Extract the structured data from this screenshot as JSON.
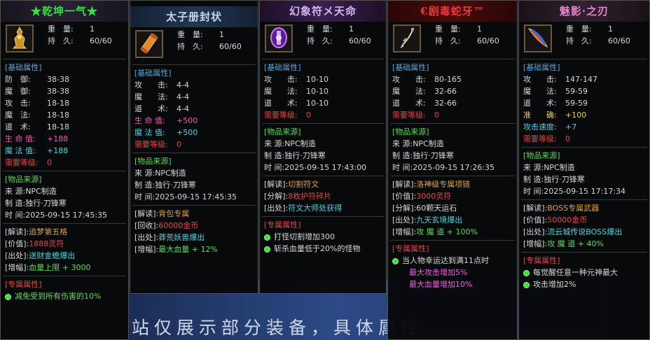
{
  "background": {
    "text": "站仅展示部分装备，具体属性"
  },
  "cards": [
    {
      "title": "★乾坤一气★",
      "title_color": "#35e040",
      "icon": "golden-idol-icon",
      "weight_label": "重　量:",
      "weight_value": "1",
      "durability_label": "持　久:",
      "durability_value": "60/60",
      "base_header": "[基础属性]",
      "stats": [
        {
          "label": "防　御:",
          "value": "38-38"
        },
        {
          "label": "魔　御:",
          "value": "38-38"
        },
        {
          "label": "攻　击:",
          "value": "18-18"
        },
        {
          "label": "魔　法:",
          "value": "18-18"
        },
        {
          "label": "道　术:",
          "value": "18-18"
        },
        {
          "label": "生 命 值:",
          "value": "+188",
          "color": "pink"
        },
        {
          "label": "魔 法 值:",
          "value": "+188",
          "color": "cyan"
        },
        {
          "label": "需要等级:",
          "value": "0",
          "color": "red"
        }
      ],
      "source_header": "[物品来源]",
      "source_lines": [
        "来 源:NPC制造",
        "制 造:独行·刀锋寒",
        "时 间:2025-09-15 17:45:35"
      ],
      "info_lines": [
        {
          "label": "[解读]:",
          "value": "追梦第五格",
          "color": "orange"
        },
        {
          "label": "[价值]:",
          "value": "1888灵符",
          "color": "red"
        },
        {
          "label": "[出处]:",
          "value": "送财金蟾爆出",
          "color": "cyan"
        },
        {
          "label": "[增幅]:",
          "value": "血量上限 + 3000",
          "color": "green"
        }
      ],
      "exclusive_header": "[专属属性]",
      "exclusive_lines": [
        "减免受到所有伤害的10%"
      ],
      "exclusive_color": "green"
    },
    {
      "title": "太子册封状",
      "title_color": "#c4d7ea",
      "icon": "scroll-icon",
      "weight_label": "重　量:",
      "weight_value": "1",
      "durability_label": "持　久:",
      "durability_value": "60/60",
      "base_header": "[基础属性]",
      "stats": [
        {
          "label": "攻　　击:",
          "value": "4-4"
        },
        {
          "label": "魔　　法:",
          "value": "4-4"
        },
        {
          "label": "道　　术:",
          "value": "4-4"
        },
        {
          "label": "生 命 值:",
          "value": "+500",
          "color": "pink"
        },
        {
          "label": "魔 法 值:",
          "value": "+500",
          "color": "cyan"
        },
        {
          "label": "需要等级:",
          "value": "0",
          "color": "red"
        }
      ],
      "source_header": "[物品来源]",
      "source_lines": [
        "来 源:NPC制造",
        "制 造:独行·刀锋寒",
        "时 间:2025-09-15 17:45:35"
      ],
      "info_lines": [
        {
          "label": "[解读]:",
          "value": "背包专属",
          "color": "orange"
        },
        {
          "label": "[回收]:",
          "value": "60000金币",
          "color": "red"
        },
        {
          "label": "[出处]:",
          "value": "莽荒妖兽爆出",
          "color": "cyan"
        },
        {
          "label": "[增幅]:",
          "value": "最大血量 + 12%",
          "color": "green"
        }
      ],
      "exclusive_header": "",
      "exclusive_lines": [],
      "exclusive_color": "white"
    },
    {
      "title": "幻象符メ天命",
      "title_color": "#d2b3ee",
      "icon": "purple-talisman-icon",
      "weight_label": "重　量:",
      "weight_value": "1",
      "durability_label": "持　久:",
      "durability_value": "60/60",
      "base_header": "[基础属性]",
      "stats": [
        {
          "label": "攻　　击:",
          "value": "10-10"
        },
        {
          "label": "魔　　法:",
          "value": "10-10"
        },
        {
          "label": "道　　术:",
          "value": "10-10"
        },
        {
          "label": "需要等级:",
          "value": "0",
          "color": "red"
        }
      ],
      "source_header": "[物品来源]",
      "source_lines": [
        "来 源:NPC制造",
        "制 造:独行·刀锋寒",
        "时 间:2025-09-15 17:43:00"
      ],
      "info_lines": [
        {
          "label": "[解读]:",
          "value": "切割符文",
          "color": "orange"
        },
        {
          "label": "[分解]:",
          "value": "8枚护符碎片",
          "color": "red"
        },
        {
          "label": "[出处]:",
          "value": "符文大师处获得",
          "color": "cyan"
        }
      ],
      "exclusive_header": "[专属属性]",
      "exclusive_lines": [
        "打怪切割增加300",
        "斩杀血量低于20%的怪物"
      ],
      "exclusive_color": "white"
    },
    {
      "title": "€剧毒蛇牙™",
      "title_color": "#ee3a3a",
      "icon": "fang-necklace-icon",
      "weight_label": "重　量:",
      "weight_value": "1",
      "durability_label": "持　久:",
      "durability_value": "60/60",
      "base_header": "[基础属性]",
      "stats": [
        {
          "label": "攻　　击:",
          "value": "80-165"
        },
        {
          "label": "魔　　法:",
          "value": "32-66"
        },
        {
          "label": "道　　术:",
          "value": "32-66"
        },
        {
          "label": "需要等级:",
          "value": "0",
          "color": "red"
        }
      ],
      "source_header": "[物品来源]",
      "source_lines": [
        "来 源:NPC制造",
        "制 造:独行·刀锋寒",
        "时 间:2025-09-15 17:26:35"
      ],
      "info_lines": [
        {
          "label": "[解读]:",
          "value": "洛神级专属项链",
          "color": "orange"
        },
        {
          "label": "[价值]:",
          "value": "3000灵符",
          "color": "red"
        },
        {
          "label": "[分解]:",
          "value": "60颗天运石",
          "color": "white"
        },
        {
          "label": "[出处]:",
          "value": "九天玄境爆出",
          "color": "cyan"
        },
        {
          "label": "[增幅]:",
          "value": "攻 魔 道 + 100%",
          "color": "green"
        }
      ],
      "exclusive_header": "[专属属性]",
      "exclusive_lines": [
        "当人物幸运达到满11点时",
        "最大攻击增加5%",
        "最大血量增加10%"
      ],
      "exclusive_color": "white"
    },
    {
      "title": "魅影·之刃",
      "title_color": "#e985c6",
      "icon": "flame-blade-icon",
      "weight_label": "重　量:",
      "weight_value": "1",
      "durability_label": "持　久:",
      "durability_value": "60/60",
      "base_header": "[基础属性]",
      "stats": [
        {
          "label": "攻　　击:",
          "value": "147-147"
        },
        {
          "label": "魔　　法:",
          "value": "59-59"
        },
        {
          "label": "道　　术:",
          "value": "59-59"
        },
        {
          "label": "准　　确:",
          "value": "+100",
          "color": "yellow"
        },
        {
          "label": "攻击速度:",
          "value": "+7",
          "color": "cyan"
        },
        {
          "label": "需要等级:",
          "value": "0",
          "color": "red"
        }
      ],
      "source_header": "[物品来源]",
      "source_lines": [
        "来 源:NPC制造",
        "制 造:独行·刀锋寒",
        "时 间:2025-09-15 17:17:34"
      ],
      "info_lines": [
        {
          "label": "[解读]:",
          "value": "BOSS专属武器",
          "color": "orange"
        },
        {
          "label": "[价值]:",
          "value": "50000金币",
          "color": "red"
        },
        {
          "label": "[出处]:",
          "value": "流云城传说BOSS爆出",
          "color": "cyan"
        },
        {
          "label": "[增幅]:",
          "value": "攻 魔 道 + 40%",
          "color": "green"
        }
      ],
      "exclusive_header": "[专属属性]",
      "exclusive_lines": [
        "每觉醒任意一种元神最大",
        "攻击增加2%"
      ],
      "exclusive_color": "white"
    }
  ]
}
